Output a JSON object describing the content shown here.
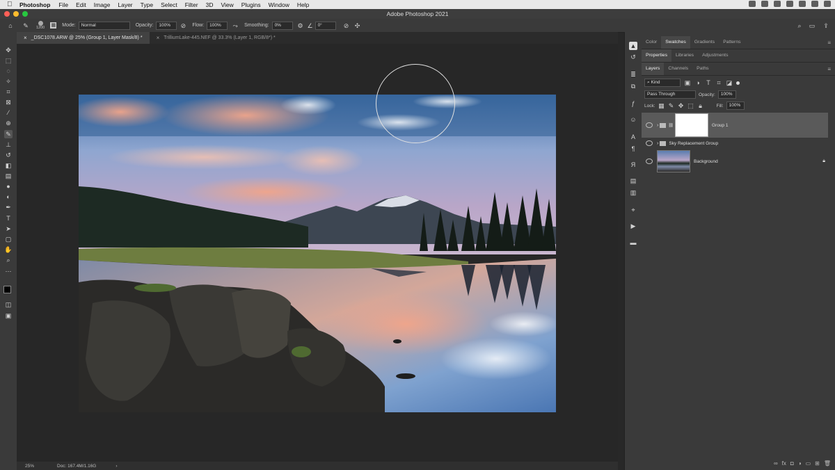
{
  "menubar": {
    "app": "Photoshop",
    "items": [
      "File",
      "Edit",
      "Image",
      "Layer",
      "Type",
      "Select",
      "Filter",
      "3D",
      "View",
      "Plugins",
      "Window",
      "Help"
    ]
  },
  "window": {
    "title": "Adobe Photoshop 2021"
  },
  "options": {
    "brush_size": "1200",
    "mode_label": "Mode:",
    "mode_value": "Normal",
    "opacity_label": "Opacity:",
    "opacity_value": "100%",
    "flow_label": "Flow:",
    "flow_value": "100%",
    "smoothing_label": "Smoothing:",
    "smoothing_value": "0%",
    "angle_value": "0°"
  },
  "tabs": [
    {
      "label": "_DSC1078.ARW @ 25% (Group 1, Layer Mask/8) *"
    },
    {
      "label": "TrilliumLake-445.NEF @ 33.3% (Layer 1, RGB/8*) *"
    }
  ],
  "status": {
    "zoom": "25%",
    "doc": "Doc: 167.4M/1.16G",
    "arrow": "›"
  },
  "panels": {
    "top_tabs": [
      "Color",
      "Swatches",
      "Gradients",
      "Patterns"
    ],
    "mid_tabs": [
      "Properties",
      "Libraries",
      "Adjustments"
    ],
    "layer_tabs": [
      "Layers",
      "Channels",
      "Paths"
    ],
    "kind_label": "Kind",
    "blend_value": "Pass Through",
    "opacity_label": "Opacity:",
    "opacity_value": "100%",
    "lock_label": "Lock:",
    "fill_label": "Fill:",
    "fill_value": "100%",
    "layers": [
      {
        "name": "Group 1"
      },
      {
        "name": "Sky Replacement Group"
      },
      {
        "name": "Background"
      }
    ]
  },
  "colors": {
    "accent": "#3d7bd6",
    "selected_layer": "#5a5a5a"
  }
}
